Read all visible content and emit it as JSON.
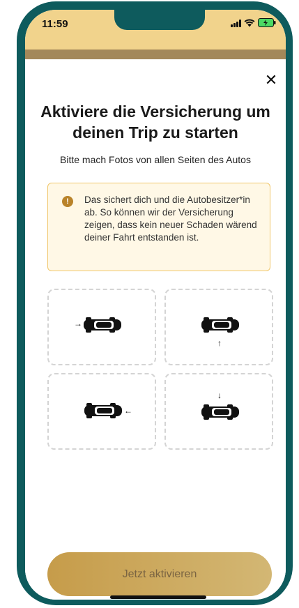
{
  "status_bar": {
    "time": "11:59",
    "icons": [
      "signal-icon",
      "wifi-icon",
      "battery-charging-icon"
    ]
  },
  "header": {
    "close_icon": "close-icon",
    "close_glyph": "✕"
  },
  "main": {
    "title": "Aktiviere die Versicherung um deinen Trip zu starten",
    "subtitle": "Bitte mach Fotos von allen Seiten des Autos",
    "info": {
      "icon": "info-icon",
      "icon_glyph": "!",
      "text": "Das sichert dich und die Autobesitzer*in ab. So können wir der Versicherung zeigen, dass kein neuer Schaden wärend deiner Fahrt entstanden ist."
    },
    "photo_slots": [
      {
        "name": "front",
        "arrow": "→",
        "icon": "car-icon"
      },
      {
        "name": "right-side",
        "arrow": "↑",
        "icon": "car-icon"
      },
      {
        "name": "back",
        "arrow": "←",
        "icon": "car-icon"
      },
      {
        "name": "left-side",
        "arrow": "↓",
        "icon": "car-icon"
      }
    ]
  },
  "footer": {
    "cta_label": "Jetzt aktivieren"
  },
  "colors": {
    "frame": "#0e5b5d",
    "status_bg": "#f1d38c",
    "backdrop": "#a3885a",
    "info_bg": "#fff8e6",
    "info_border": "#f0c66a",
    "info_icon": "#b9832a",
    "cta_start": "#c69c4a",
    "cta_end": "#d3b774"
  }
}
